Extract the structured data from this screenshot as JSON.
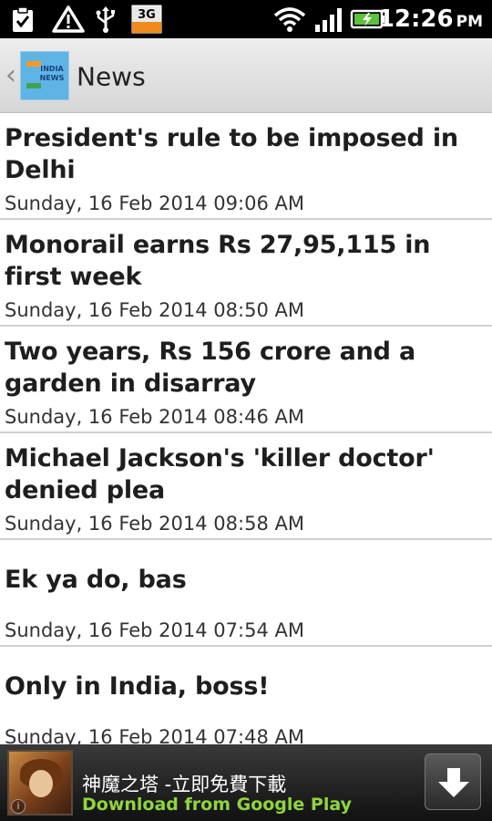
{
  "status_bar": {
    "network_type": "3G",
    "time": "12:26",
    "ampm": "PM",
    "icons": [
      "clipboard-check-icon",
      "warning-icon",
      "usb-icon",
      "3g-icon",
      "wifi-icon",
      "signal-icon",
      "battery-charging-icon"
    ]
  },
  "title_bar": {
    "title": "News",
    "logo_text": "INDIA NEWS",
    "back_icon": "chevron-left-icon"
  },
  "news": [
    {
      "headline": "President's rule to be imposed in Delhi",
      "date": "Sunday, 16 Feb 2014 09:06 AM"
    },
    {
      "headline": "Monorail earns Rs 27,95,115 in first week",
      "date": "Sunday, 16 Feb 2014 08:50 AM"
    },
    {
      "headline": "Two years, Rs 156 crore and a garden in disarray",
      "date": "Sunday, 16 Feb 2014 08:46 AM"
    },
    {
      "headline": "Michael Jackson's 'killer doctor' denied plea",
      "date": "Sunday, 16 Feb 2014 08:58 AM"
    },
    {
      "headline": "Ek ya do, bas",
      "date": "Sunday, 16 Feb 2014 07:54 AM"
    },
    {
      "headline": "Only in India, boss!",
      "date": "Sunday, 16 Feb 2014 07:48 AM"
    }
  ],
  "ad": {
    "title": "神魔之塔 -立即免費下載",
    "subtitle": "Download from Google Play",
    "info_icon": "info-icon",
    "download_icon": "download-arrow-icon"
  },
  "colors": {
    "status_bar_bg": "#000000",
    "title_bar_bg": "#dcdcdc",
    "ad_subtitle": "#8fd63a"
  }
}
